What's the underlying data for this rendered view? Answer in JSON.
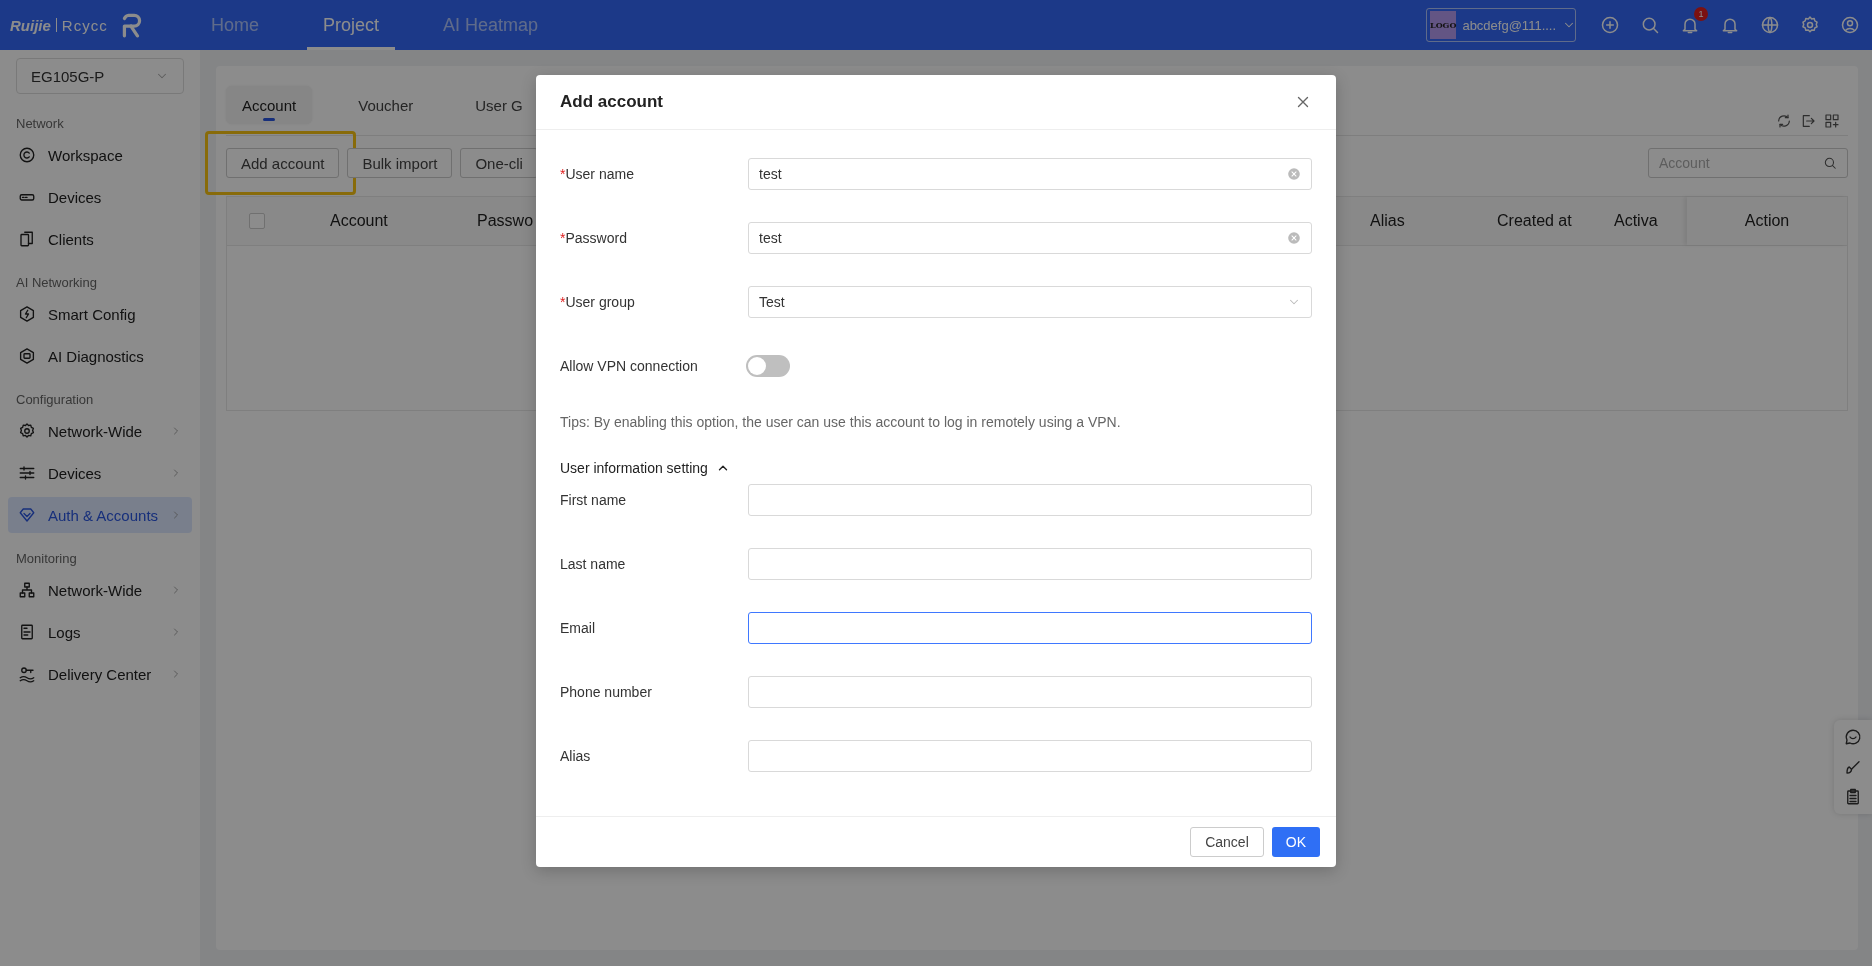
{
  "top_bar": {
    "brand": {
      "name": "Ruijie",
      "product": "Rcycc"
    },
    "nav": [
      {
        "label": "Home",
        "selected": false
      },
      {
        "label": "Project",
        "selected": true
      },
      {
        "label": "AI Heatmap",
        "selected": false
      }
    ],
    "account": {
      "logo": "LOGO",
      "name": "abcdefg@111...."
    },
    "notification_badge": "1"
  },
  "sidebar": {
    "site": "EG105G-P",
    "sections": [
      {
        "title": "Network",
        "items": [
          {
            "label": "Workspace",
            "has_submenu": false,
            "selected": false
          },
          {
            "label": "Devices",
            "has_submenu": false,
            "selected": false
          },
          {
            "label": "Clients",
            "has_submenu": false,
            "selected": false
          }
        ]
      },
      {
        "title": "AI Networking",
        "items": [
          {
            "label": "Smart Config",
            "has_submenu": false,
            "selected": false
          },
          {
            "label": "AI Diagnostics",
            "has_submenu": false,
            "selected": false
          }
        ]
      },
      {
        "title": "Configuration",
        "items": [
          {
            "label": "Network-Wide",
            "has_submenu": true,
            "selected": false
          },
          {
            "label": "Devices",
            "has_submenu": true,
            "selected": false
          },
          {
            "label": "Auth & Accounts",
            "has_submenu": true,
            "selected": true
          }
        ]
      },
      {
        "title": "Monitoring",
        "items": [
          {
            "label": "Network-Wide",
            "has_submenu": true,
            "selected": false
          },
          {
            "label": "Logs",
            "has_submenu": true,
            "selected": false
          },
          {
            "label": "Delivery Center",
            "has_submenu": true,
            "selected": false
          }
        ]
      }
    ]
  },
  "content": {
    "tabs": [
      {
        "label": "Account",
        "selected": true
      },
      {
        "label": "Voucher",
        "selected": false
      },
      {
        "label": "User G",
        "selected": false
      }
    ],
    "buttons": [
      {
        "label": "Add account",
        "highlighted": true
      },
      {
        "label": "Bulk import",
        "highlighted": false
      },
      {
        "label": "One-cli",
        "highlighted": false
      }
    ],
    "search": {
      "placeholder": "Account"
    },
    "table": {
      "select_all": {
        "checked": false
      },
      "columns": [
        "Account",
        "Passwo",
        "Alias",
        "Created at",
        "Activa",
        "Action"
      ]
    }
  },
  "dialog": {
    "title": "Add account",
    "required_mark": "*",
    "fields": [
      {
        "label": "User name",
        "kind": "text",
        "required": true,
        "value": "test",
        "clearable": true,
        "focused": false
      },
      {
        "label": "Password",
        "kind": "text",
        "required": true,
        "value": "test",
        "clearable": true,
        "focused": false
      },
      {
        "label": "User group",
        "kind": "select",
        "required": true,
        "value": "Test",
        "focused": false
      },
      {
        "label": "Allow VPN connection",
        "kind": "toggle",
        "required": false,
        "on": false
      }
    ],
    "tips": "Tips: By enabling this option, the user can use this account to log in remotely using a VPN.",
    "section": {
      "title": "User information setting",
      "expanded": true,
      "fields": [
        {
          "label": "First name",
          "focused": false
        },
        {
          "label": "Last name",
          "focused": false
        },
        {
          "label": "Email",
          "focused": true
        },
        {
          "label": "Phone number",
          "focused": false
        },
        {
          "label": "Alias",
          "focused": false
        }
      ]
    },
    "buttons": {
      "cancel": "Cancel",
      "ok": "OK"
    }
  }
}
